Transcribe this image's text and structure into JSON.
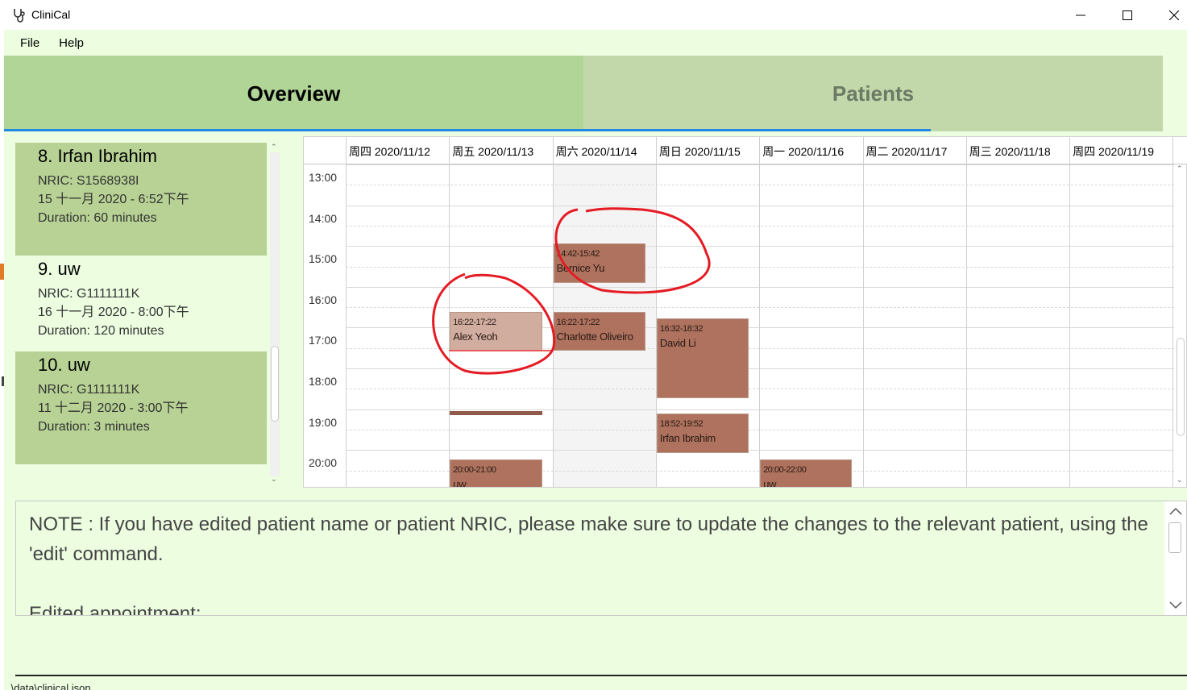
{
  "window": {
    "title": "CliniCal"
  },
  "menu": [
    "File",
    "Help"
  ],
  "tabs": [
    {
      "label": "Overview",
      "active": true
    },
    {
      "label": "Patients",
      "active": false
    }
  ],
  "appointments": [
    {
      "header": "8.  Irfan Ibrahim",
      "nric": "NRIC: S1568938I",
      "datetime": "15 十一月 2020 - 6:52下午",
      "duration": "Duration: 60 minutes"
    },
    {
      "header": "9.  uw",
      "nric": "NRIC: G1111111K",
      "datetime": "16 十一月 2020 - 8:00下午",
      "duration": "Duration: 120 minutes"
    },
    {
      "header": "10.  uw",
      "nric": "NRIC: G1111111K",
      "datetime": "11 十二月 2020 - 3:00下午",
      "duration": "Duration: 3 minutes"
    }
  ],
  "calendar": {
    "days": [
      "周四 2020/11/12",
      "周五 2020/11/13",
      "周六 2020/11/14",
      "周日 2020/11/15",
      "周一 2020/11/16",
      "周二 2020/11/17",
      "周三 2020/11/18",
      "周四 2020/11/19"
    ],
    "times": [
      "13:00",
      "14:00",
      "15:00",
      "16:00",
      "17:00",
      "18:00",
      "19:00",
      "20:00"
    ],
    "events": [
      {
        "day": 2,
        "start": 14.7,
        "end": 15.7,
        "time": "14:42-15:42",
        "name": "Bernice Yu",
        "selected": false
      },
      {
        "day": 1,
        "start": 16.37,
        "end": 17.37,
        "time": "16:22-17:22",
        "name": "Alex Yeoh",
        "selected": true
      },
      {
        "day": 2,
        "start": 16.37,
        "end": 17.37,
        "time": "16:22-17:22",
        "name": "Charlotte Oliveiro",
        "selected": false
      },
      {
        "day": 3,
        "start": 16.53,
        "end": 18.53,
        "time": "16:32-18:32",
        "name": "David Li",
        "selected": false
      },
      {
        "day": 3,
        "start": 18.87,
        "end": 19.87,
        "time": "18:52-19:52",
        "name": "Irfan Ibrahim",
        "selected": false
      },
      {
        "day": 1,
        "start": 20.0,
        "end": 21.0,
        "time": "20:00-21:00",
        "name": "uw",
        "selected": false
      },
      {
        "day": 4,
        "start": 20.0,
        "end": 22.0,
        "time": "20:00-22:00",
        "name": "uw",
        "selected": false
      }
    ]
  },
  "note": {
    "line1": "NOTE : If you have edited patient name or patient NRIC, please make sure to update the changes to the relevant patient, using the",
    "line2": "'edit' command.",
    "line3": "Edited appointment:"
  },
  "status": {
    "path": ".\\data\\clinical.json"
  },
  "icons": {
    "app": "stethoscope-icon",
    "minimize": "minimize-icon",
    "maximize": "maximize-icon",
    "close": "close-icon"
  },
  "colors": {
    "tab_active": "#b1d597",
    "appointment": "#ae725e",
    "selected_appointment": "#d1ada0",
    "annotation": "#e51b24"
  }
}
